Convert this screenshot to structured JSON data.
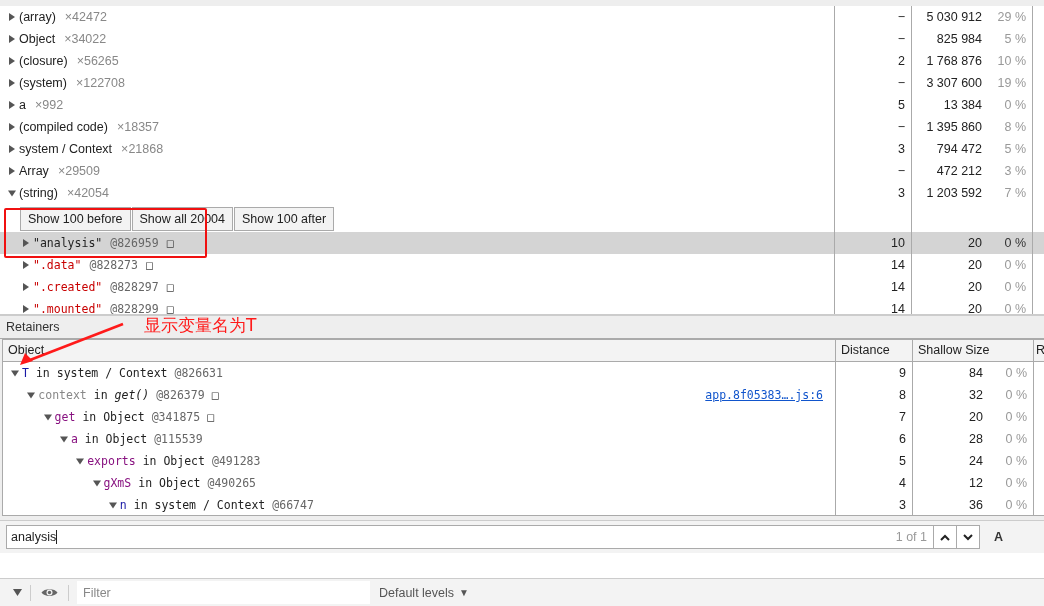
{
  "summary": {
    "rows": [
      {
        "name": "(array)",
        "count": "×42472",
        "expanded": false,
        "distance": "−",
        "shallow_size": "5 030 912",
        "percent": "29 %"
      },
      {
        "name": "Object",
        "count": "×34022",
        "expanded": false,
        "distance": "−",
        "shallow_size": "825 984",
        "percent": "5 %"
      },
      {
        "name": "(closure)",
        "count": "×56265",
        "expanded": false,
        "distance": "2",
        "shallow_size": "1 768 876",
        "percent": "10 %"
      },
      {
        "name": "(system)",
        "count": "×122708",
        "expanded": false,
        "distance": "−",
        "shallow_size": "3 307 600",
        "percent": "19 %"
      },
      {
        "name": "a",
        "count": "×992",
        "expanded": false,
        "distance": "5",
        "shallow_size": "13 384",
        "percent": "0 %"
      },
      {
        "name": "(compiled code)",
        "count": "×18357",
        "expanded": false,
        "distance": "−",
        "shallow_size": "1 395 860",
        "percent": "8 %"
      },
      {
        "name": "system / Context",
        "count": "×21868",
        "expanded": false,
        "distance": "3",
        "shallow_size": "794 472",
        "percent": "5 %"
      },
      {
        "name": "Array",
        "count": "×29509",
        "expanded": false,
        "distance": "−",
        "shallow_size": "472 212",
        "percent": "3 %"
      },
      {
        "name": "(string)",
        "count": "×42054",
        "expanded": true,
        "distance": "3",
        "shallow_size": "1 203 592",
        "percent": "7 %",
        "paging_buttons": [
          "Show 100 before",
          "Show all 20004",
          "Show 100 after"
        ],
        "children": [
          {
            "value": "\"analysis\"",
            "id": "@826959",
            "glyph": "□",
            "selected": true,
            "distance": "10",
            "shallow_size": "20",
            "percent": "0 %"
          },
          {
            "value": "\".data\"",
            "id": "@828273",
            "glyph": "□",
            "selected": false,
            "distance": "14",
            "shallow_size": "20",
            "percent": "0 %"
          },
          {
            "value": "\".created\"",
            "id": "@828297",
            "glyph": "□",
            "selected": false,
            "distance": "14",
            "shallow_size": "20",
            "percent": "0 %"
          },
          {
            "value": "\".mounted\"",
            "id": "@828299",
            "glyph": "□",
            "selected": false,
            "distance": "14",
            "shallow_size": "20",
            "percent": "0 %"
          }
        ]
      }
    ]
  },
  "retainers": {
    "title": "Retainers",
    "columns": [
      "Object",
      "Distance",
      "Shallow Size",
      "R"
    ],
    "tree": [
      {
        "name": "T",
        "expanded": true,
        "kind": "variable",
        "owner": "in system / Context",
        "id": "@826631",
        "distance": "9",
        "shallow_size": "84",
        "percent": "0 %",
        "children": [
          {
            "name": "context",
            "expanded": true,
            "kind": "internal",
            "owner": "in *get()*",
            "id": "@826379",
            "glyph": "□",
            "link": "app.8f05383….js:6",
            "distance": "8",
            "shallow_size": "32",
            "percent": "0 %",
            "children": [
              {
                "name": "get",
                "expanded": true,
                "kind": "property",
                "owner": "in Object",
                "id": "@341875",
                "glyph": "□",
                "distance": "7",
                "shallow_size": "20",
                "percent": "0 %",
                "children": [
                  {
                    "name": "a",
                    "expanded": true,
                    "kind": "property",
                    "owner": "in Object",
                    "id": "@115539",
                    "distance": "6",
                    "shallow_size": "28",
                    "percent": "0 %",
                    "children": [
                      {
                        "name": "exports",
                        "expanded": true,
                        "kind": "property",
                        "owner": "in Object",
                        "id": "@491283",
                        "distance": "5",
                        "shallow_size": "24",
                        "percent": "0 %",
                        "children": [
                          {
                            "name": "gXmS",
                            "expanded": true,
                            "kind": "property",
                            "owner": "in Object",
                            "id": "@490265",
                            "distance": "4",
                            "shallow_size": "12",
                            "percent": "0 %",
                            "children": [
                              {
                                "name": "n",
                                "expanded": true,
                                "kind": "variable",
                                "owner": "in system / Context",
                                "id": "@66747",
                                "distance": "3",
                                "shallow_size": "36",
                                "percent": "0 %"
                              }
                            ]
                          }
                        ]
                      }
                    ]
                  }
                ]
              }
            ]
          }
        ]
      }
    ]
  },
  "search": {
    "value": "analysis",
    "match_count": "1 of 1",
    "cut_label": "A"
  },
  "console_bar": {
    "filter_placeholder": "Filter",
    "levels": "Default levels",
    "levels_caret": "▼"
  },
  "annotation": {
    "note": "显示变量名为T"
  }
}
